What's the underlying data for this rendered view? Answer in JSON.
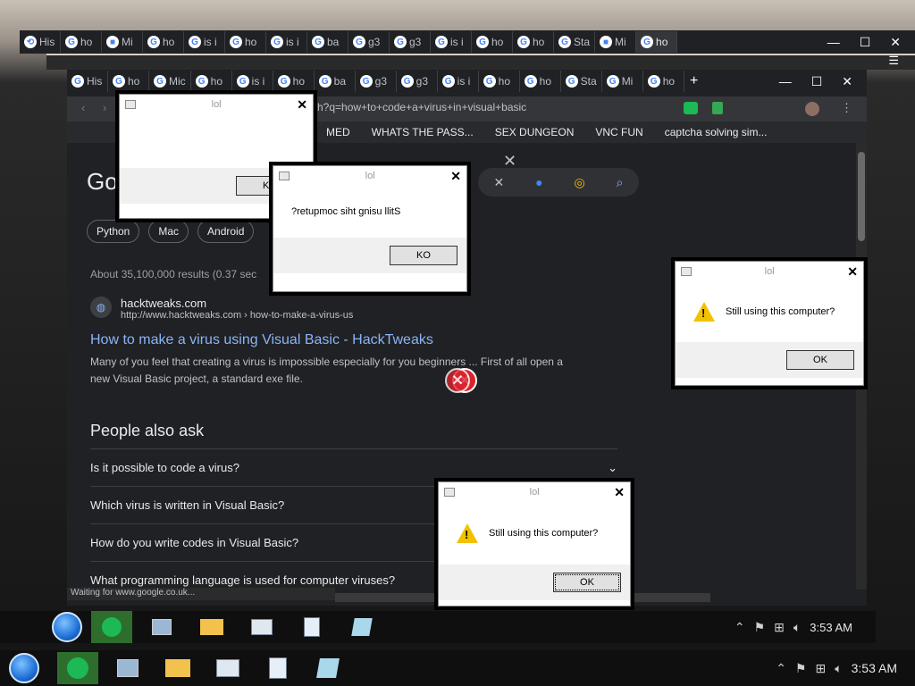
{
  "outer_browser": {
    "tabs": [
      {
        "label": "His",
        "icon": "history-icon"
      },
      {
        "label": "ho",
        "icon": "google-icon"
      },
      {
        "label": "Mi",
        "icon": "microsoft-icon"
      },
      {
        "label": "ho",
        "icon": "google-icon"
      },
      {
        "label": "is i",
        "icon": "google-icon"
      },
      {
        "label": "ho",
        "icon": "google-icon"
      },
      {
        "label": "is i",
        "icon": "google-icon"
      },
      {
        "label": "ba",
        "icon": "google-icon"
      },
      {
        "label": "g3",
        "icon": "google-icon"
      },
      {
        "label": "g3",
        "icon": "google-icon"
      },
      {
        "label": "is i",
        "icon": "google-icon"
      },
      {
        "label": "ho",
        "icon": "google-icon"
      },
      {
        "label": "ho",
        "icon": "google-icon"
      },
      {
        "label": "Sta",
        "icon": "opera-icon"
      },
      {
        "label": "Mi",
        "icon": "microsoft-icon"
      },
      {
        "label": "ho",
        "icon": "google-icon",
        "active": true
      }
    ]
  },
  "inner_browser": {
    "tabs": [
      {
        "label": "His"
      },
      {
        "label": "ho"
      },
      {
        "label": "Mic"
      },
      {
        "label": "ho"
      },
      {
        "label": "is i"
      },
      {
        "label": "ho"
      },
      {
        "label": "ba"
      },
      {
        "label": "g3"
      },
      {
        "label": "g3"
      },
      {
        "label": "is i"
      },
      {
        "label": "ho"
      },
      {
        "label": "ho"
      },
      {
        "label": "Sta"
      },
      {
        "label": "Mi"
      },
      {
        "label": "ho"
      }
    ],
    "url": "h?q=how+to+code+a+virus+in+visual+basic",
    "bookmarks": [
      "MED",
      "WHATS THE PASS...",
      "SEX DUNGEON",
      "VNC FUN",
      "captcha solving sim..."
    ],
    "new_tab_symbol": "+"
  },
  "search_page": {
    "logo": "Go",
    "chips": [
      "Python",
      "Mac",
      "Android"
    ],
    "result_stats": "About 35,100,000 results (0.37 sec",
    "result": {
      "site_name": "hacktweaks.com",
      "site_path": "http://www.hacktweaks.com › how-to-make-a-virus-us",
      "title": "How to make a virus using Visual Basic - HackTweaks",
      "snippet": "Many of you feel that creating a virus is impossible especially for you beginners ... First of all open a new Visual Basic project, a standard exe file."
    },
    "people_also_ask": {
      "heading": "People also ask",
      "questions": [
        "Is it possible to code a virus?",
        "Which virus is written in Visual Basic?",
        "How do you write codes in Visual Basic?",
        "What programming language is used for computer viruses?"
      ]
    },
    "status_text": "Waiting for www.google.co.uk..."
  },
  "dialogs": {
    "blank": {
      "title": "lol",
      "button": "KO"
    },
    "reversed": {
      "title": "lol",
      "message": "?retupmoc siht gnisu llitS",
      "button": "KO"
    },
    "right": {
      "title": "lol",
      "message": "Still using this computer?",
      "button": "OK"
    },
    "bottom": {
      "title": "lol",
      "message": "Still using this computer?",
      "button": "OK"
    }
  },
  "taskbar": {
    "time_inner": "3:53 AM",
    "time_outer": "3:53 AM"
  },
  "colors": {
    "link": "#8ab4f8",
    "chrome_dark": "#202124",
    "warning": "#f2c200",
    "error": "#d9232d",
    "spotify_green": "#2d6e2d"
  }
}
